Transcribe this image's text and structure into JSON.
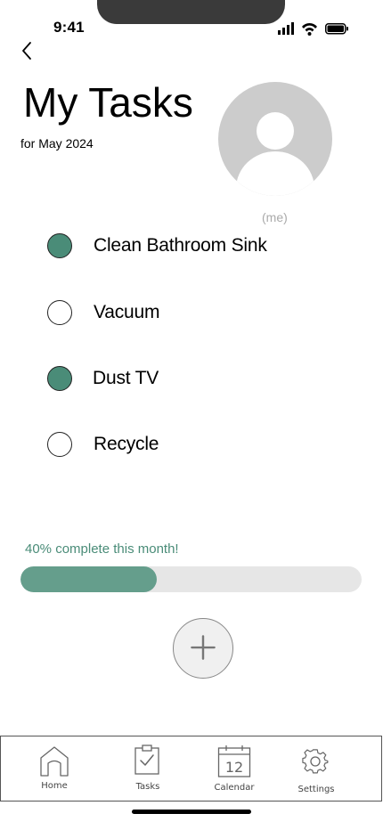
{
  "status_bar": {
    "time": "9:41"
  },
  "header": {
    "title": "My Tasks",
    "subtitle": "for May 2024",
    "avatar_caption": "(me)"
  },
  "tasks": [
    {
      "label": "Clean Bathroom Sink",
      "done": true
    },
    {
      "label": "Vacuum",
      "done": false
    },
    {
      "label": "Dust TV",
      "done": true
    },
    {
      "label": "Recycle",
      "done": false
    }
  ],
  "progress": {
    "text": "40% complete this month!",
    "percent": 40
  },
  "tabs": [
    {
      "label": "Home",
      "icon": "home-icon"
    },
    {
      "label": "Tasks",
      "icon": "clipboard-check-icon"
    },
    {
      "label": "Calendar",
      "icon": "calendar-icon",
      "icon_text": "12"
    },
    {
      "label": "Settings",
      "icon": "gear-icon"
    }
  ],
  "colors": {
    "accent": "#4a8c78",
    "progress_fill": "#659e8c",
    "progress_track": "#e6e6e6",
    "avatar": "#cccccc"
  }
}
